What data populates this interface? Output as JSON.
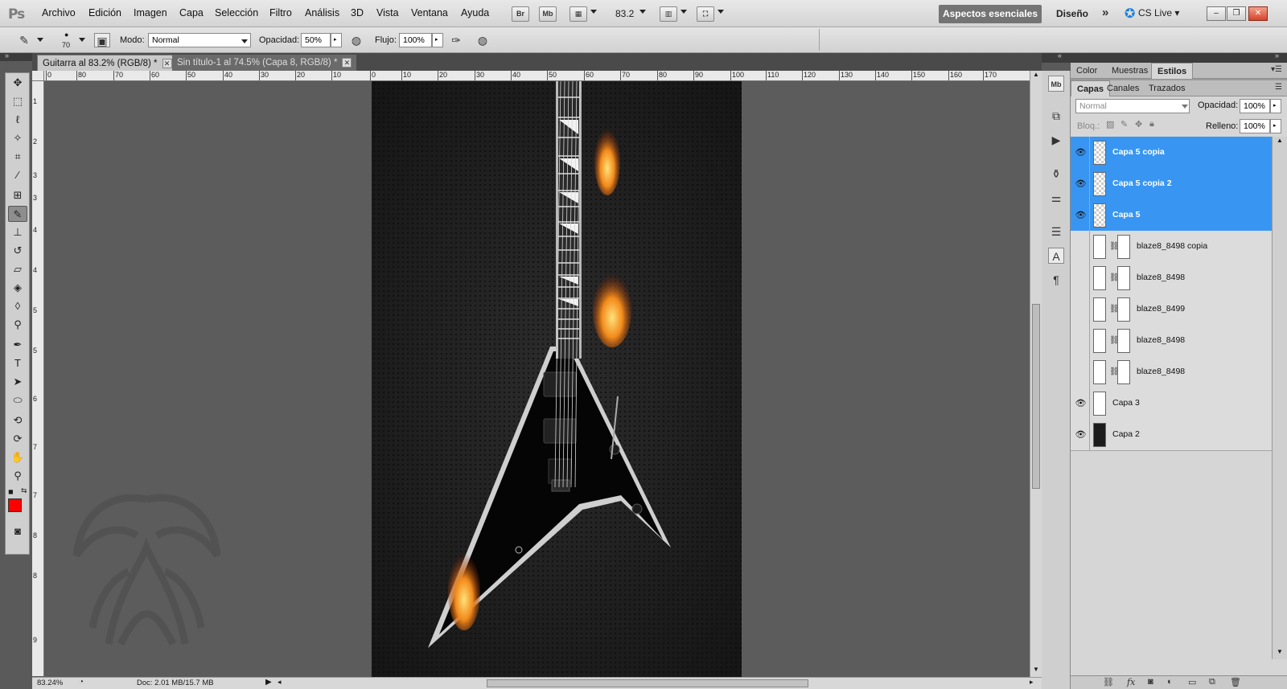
{
  "app": {
    "logo": "Ps"
  },
  "menu": [
    "Archivo",
    "Edición",
    "Imagen",
    "Capa",
    "Selección",
    "Filtro",
    "Análisis",
    "3D",
    "Vista",
    "Ventana",
    "Ayuda"
  ],
  "menubar_buttons": {
    "bridge": "Br",
    "minibridge": "Mb",
    "zoom": "83.2"
  },
  "workspace": {
    "active": "Aspectos esenciales",
    "design": "Diseño",
    "more": "»",
    "cs_live": "CS Live ▾"
  },
  "window_controls": {
    "minimize": "–",
    "restore": "❐",
    "close": "✕"
  },
  "options": {
    "brush_size": "70",
    "mode_label": "Modo:",
    "mode_value": "Normal",
    "opacity_label": "Opacidad:",
    "opacity_value": "50%",
    "flow_label": "Flujo:",
    "flow_value": "100%"
  },
  "tabs": [
    {
      "label": "Guitarra al 83.2% (RGB/8) *",
      "active": true
    },
    {
      "label": "Sin título-1 al 74.5% (Capa 8, RGB/8) *",
      "active": false
    }
  ],
  "ruler_h": [
    "0",
    "80",
    "70",
    "60",
    "50",
    "40",
    "30",
    "20",
    "10",
    "0",
    "10",
    "20",
    "30",
    "40",
    "50",
    "60",
    "70",
    "80",
    "90",
    "100",
    "110",
    "120",
    "130",
    "140",
    "150",
    "160",
    "170"
  ],
  "ruler_v": [
    "1",
    "2",
    "3",
    "3",
    "4",
    "4",
    "5",
    "5",
    "6",
    "7",
    "7",
    "8",
    "8",
    "9"
  ],
  "status": {
    "zoom": "83.24%",
    "doc": "Doc: 2.01 MB/15.7 MB"
  },
  "panels": {
    "top_tabs": [
      "Color",
      "Muestras",
      "Estilos"
    ],
    "layer_tabs": [
      "Capas",
      "Canales",
      "Trazados"
    ],
    "blend_mode": "Normal",
    "opacity_label": "Opacidad:",
    "opacity_value": "100%",
    "lock_label": "Bloq.:",
    "fill_label": "Relleno:",
    "fill_value": "100%"
  },
  "layers": [
    {
      "name": "Capa 5 copia",
      "visible": true,
      "selected": true,
      "thumb": "checker",
      "mask": false
    },
    {
      "name": "Capa 5 copia 2",
      "visible": true,
      "selected": true,
      "thumb": "checker",
      "mask": false
    },
    {
      "name": "Capa 5",
      "visible": true,
      "selected": true,
      "thumb": "checker",
      "mask": false
    },
    {
      "name": "blaze8_8498 copia",
      "visible": false,
      "selected": false,
      "thumb": "white",
      "mask": true
    },
    {
      "name": "blaze8_8498",
      "visible": false,
      "selected": false,
      "thumb": "white",
      "mask": true
    },
    {
      "name": "blaze8_8499",
      "visible": false,
      "selected": false,
      "thumb": "white",
      "mask": true
    },
    {
      "name": "blaze8_8498",
      "visible": false,
      "selected": false,
      "thumb": "white",
      "mask": true
    },
    {
      "name": "blaze8_8498",
      "visible": false,
      "selected": false,
      "thumb": "white",
      "mask": true
    },
    {
      "name": "Capa 3",
      "visible": true,
      "selected": false,
      "thumb": "white",
      "mask": false
    },
    {
      "name": "Capa 2",
      "visible": true,
      "selected": false,
      "thumb": "dark",
      "mask": false
    }
  ],
  "colors": {
    "foreground": "#ff0000",
    "background": "#1b8de0",
    "selection": "#3896f2"
  }
}
